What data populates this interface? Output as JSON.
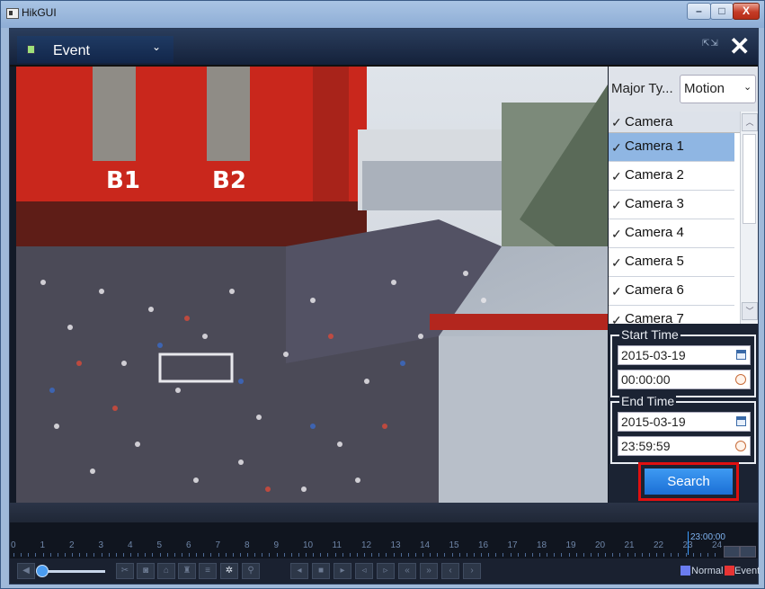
{
  "window": {
    "title": "HikGUI",
    "min_glyph": "–",
    "max_glyph": "□",
    "close_glyph": "X"
  },
  "topbar": {
    "menu_label": "Event",
    "close_glyph": "✕",
    "fullscreen_glyph": "⇱⇲"
  },
  "search_panel": {
    "major_type_label": "Major Ty...",
    "major_type_value": "Motion",
    "camera_header": "Camera",
    "cameras": [
      "Camera 1",
      "Camera 2",
      "Camera 3",
      "Camera 4",
      "Camera 5",
      "Camera 6",
      "Camera 7"
    ],
    "selected_camera_index": 0,
    "start_time": {
      "legend": "Start Time",
      "date": "2015-03-19",
      "time": "00:00:00"
    },
    "end_time": {
      "legend": "End Time",
      "date": "2015-03-19",
      "time": "23:59:59"
    },
    "search_label": "Search"
  },
  "video": {
    "banner_left": "B1",
    "banner_right": "B2"
  },
  "timeline": {
    "hours": [
      "0",
      "1",
      "2",
      "3",
      "4",
      "5",
      "6",
      "7",
      "8",
      "9",
      "10",
      "11",
      "12",
      "13",
      "14",
      "15",
      "16",
      "17",
      "18",
      "19",
      "20",
      "21",
      "22",
      "23",
      "24"
    ],
    "cursor_time": "23:00:00"
  },
  "legend": {
    "normal_label": "Normal",
    "event_label": "Event",
    "normal_color": "#6a7cf0",
    "event_color": "#e83434"
  },
  "colors": {
    "accent": "#1b6fd6",
    "highlight": "#e01010"
  }
}
